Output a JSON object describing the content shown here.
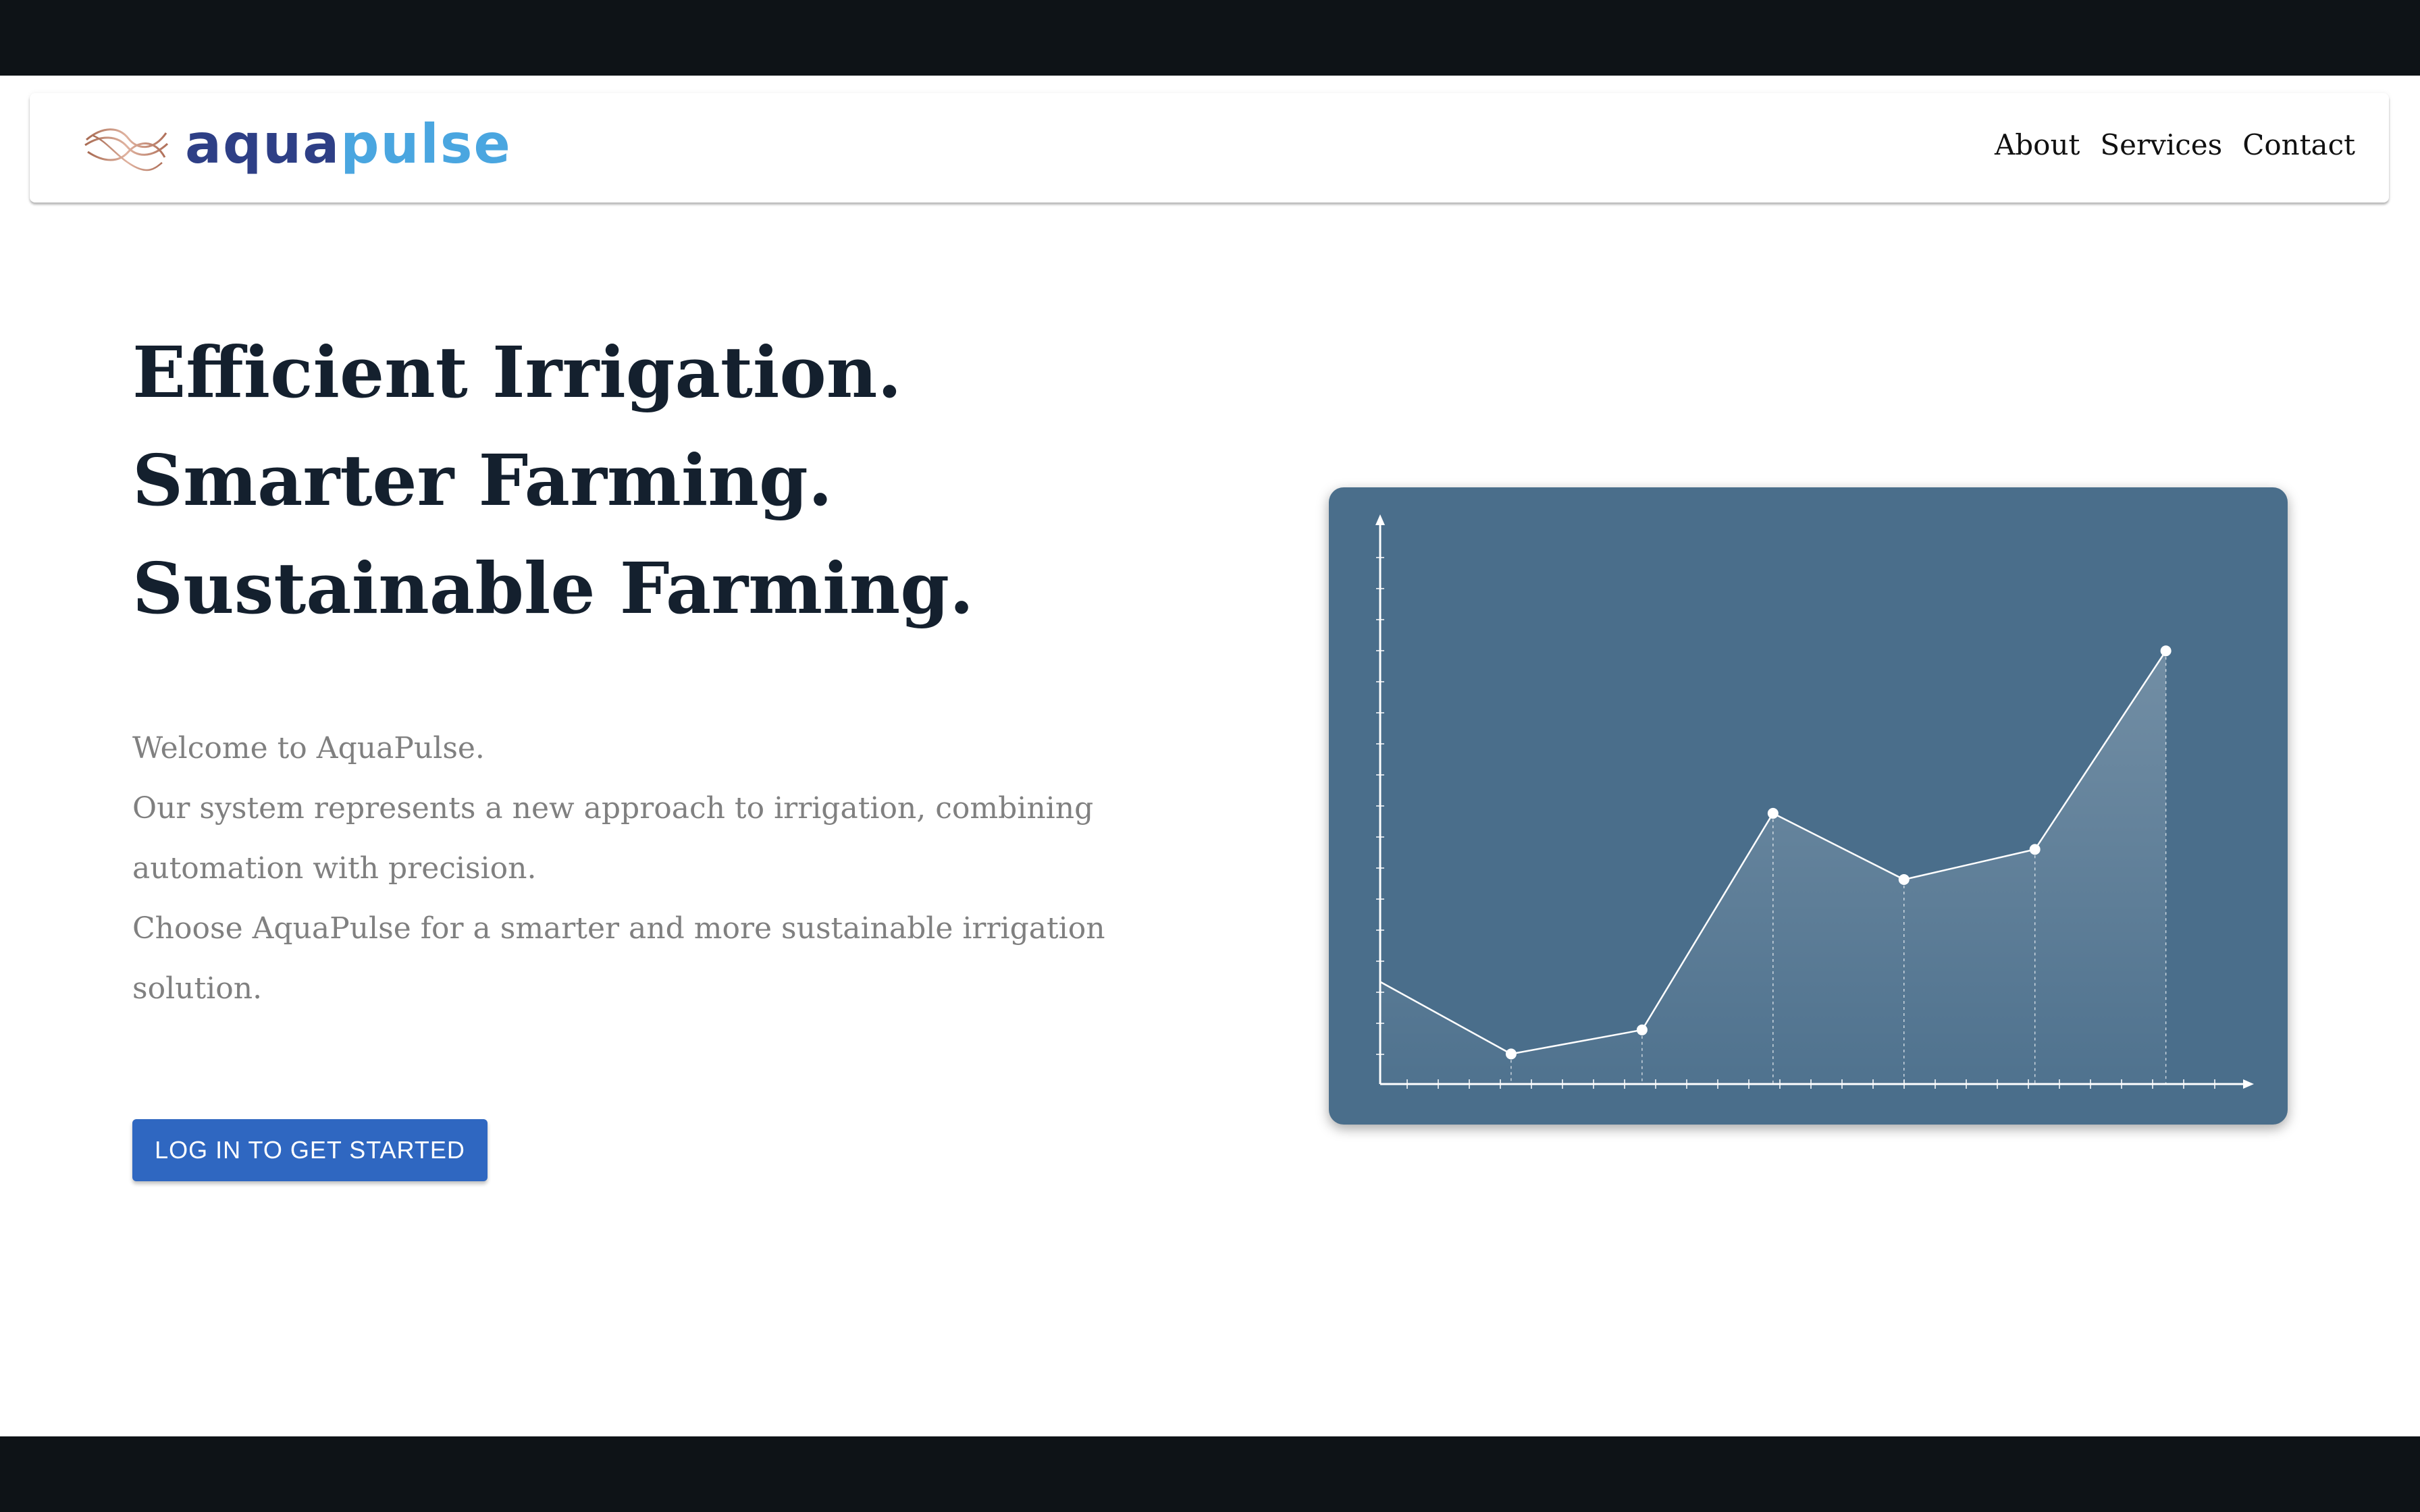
{
  "header": {
    "logo_text_1": "aqua",
    "logo_text_2": "pulse",
    "nav": [
      {
        "label": "About"
      },
      {
        "label": "Services"
      },
      {
        "label": "Contact"
      }
    ]
  },
  "hero": {
    "headline": [
      "Efficient Irrigation.",
      "Smarter Farming.",
      "Sustainable Farming."
    ],
    "paragraphs": [
      "Welcome to AquaPulse.",
      "Our system represents a new approach to irrigation, combining automation with precision.",
      "Choose AquaPulse for a smarter and more sustainable irrigation solution."
    ],
    "cta_label": "LOG IN TO GET STARTED"
  },
  "colors": {
    "dark_bar": "#0e1317",
    "heading": "#14202e",
    "body_text": "#808080",
    "button": "#2f67c1",
    "chart_bg": "#4a6e8b",
    "logo_aqua": "#2e3f86",
    "logo_pulse": "#4aa6e0"
  },
  "chart_data": {
    "type": "area",
    "x": [
      0,
      1,
      2,
      3,
      4,
      5,
      6
    ],
    "values": [
      17,
      5,
      9,
      45,
      34,
      39,
      72
    ],
    "ylim": [
      0,
      92
    ],
    "xlim": [
      0,
      6.6
    ],
    "grid": false,
    "markers_from_index": 1,
    "drop_lines": true
  }
}
